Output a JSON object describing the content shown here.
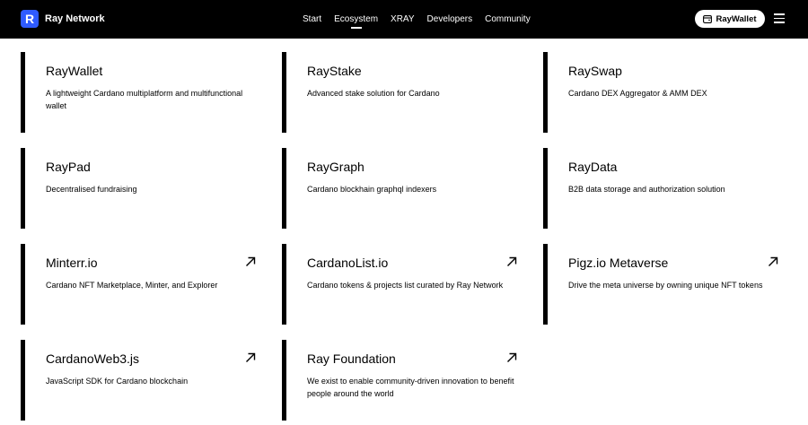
{
  "header": {
    "brand_logo": "R",
    "brand_name": "Ray Network",
    "nav": [
      {
        "label": "Start",
        "active": false
      },
      {
        "label": "Ecosystem",
        "active": true
      },
      {
        "label": "XRAY",
        "active": false
      },
      {
        "label": "Developers",
        "active": false
      },
      {
        "label": "Community",
        "active": false
      }
    ],
    "wallet_button": "RayWallet",
    "wallet_icon": "wallet-icon",
    "menu_icon": "hamburger-menu-icon",
    "brand_color": "#2f5bff"
  },
  "cards": [
    {
      "title": "RayWallet",
      "desc": "A lightweight Cardano multiplatform and multifunctional wallet",
      "external": false
    },
    {
      "title": "RayStake",
      "desc": "Advanced stake solution for Cardano",
      "external": false
    },
    {
      "title": "RaySwap",
      "desc": "Cardano DEX Aggregator & AMM DEX",
      "external": false
    },
    {
      "title": "RayPad",
      "desc": "Decentralised fundraising",
      "external": false
    },
    {
      "title": "RayGraph",
      "desc": "Cardano blockhain graphql indexers",
      "external": false
    },
    {
      "title": "RayData",
      "desc": "B2B data storage and authorization solution",
      "external": false
    },
    {
      "title": "Minterr.io",
      "desc": "Cardano NFT Marketplace, Minter, and Explorer",
      "external": true
    },
    {
      "title": "CardanoList.io",
      "desc": "Cardano tokens & projects list curated by Ray Network",
      "external": true
    },
    {
      "title": "Pigz.io Metaverse",
      "desc": "Drive the meta universe by owning unique NFT tokens",
      "external": true
    },
    {
      "title": "CardanoWeb3.js",
      "desc": "JavaScript SDK for Cardano blockchain",
      "external": true
    },
    {
      "title": "Ray Foundation",
      "desc": "We exist to enable community-driven innovation to benefit people around the world",
      "external": true
    }
  ]
}
